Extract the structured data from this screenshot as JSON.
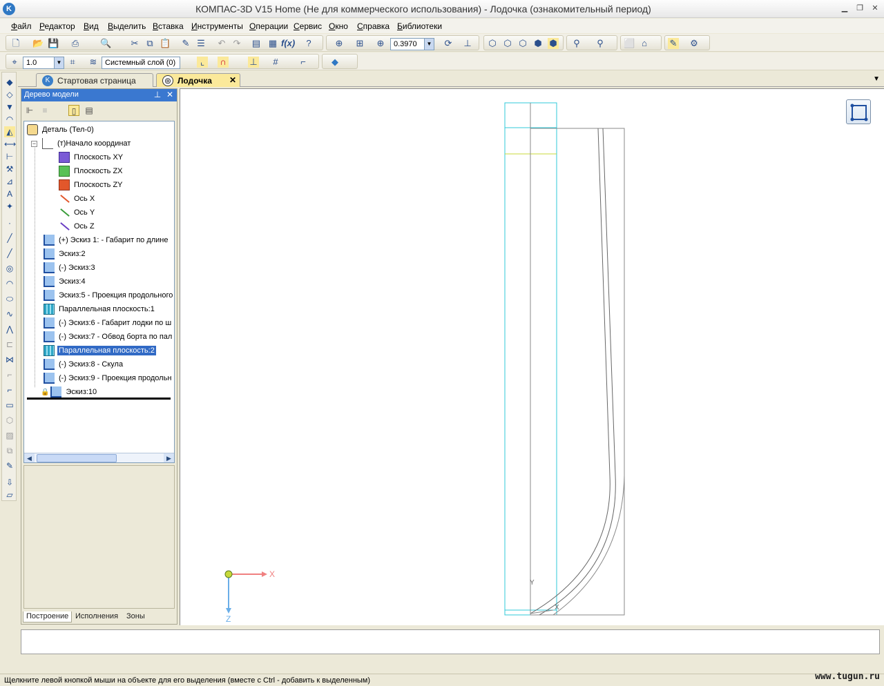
{
  "window": {
    "title": "КОМПАС-3D V15 Home (Не для коммерческого использования) - Лодочка (ознакомительный период)",
    "icon": "kompas-icon"
  },
  "menu": [
    "Файл",
    "Редактор",
    "Вид",
    "Выделить",
    "Вставка",
    "Инструменты",
    "Операции",
    "Сервис",
    "Окно",
    "Справка",
    "Библиотеки"
  ],
  "toolbar": {
    "zoom_value": "0.3970",
    "step_value": "1.0",
    "layer_value": "Системный слой (0)"
  },
  "tabs": [
    {
      "label": "Стартовая страница",
      "active": false
    },
    {
      "label": "Лодочка",
      "active": true
    }
  ],
  "tree_panel": {
    "title": "Дерево модели",
    "root": "Деталь (Тел-0)",
    "origin": "(т)Начало координат",
    "origin_children": [
      "Плоскость XY",
      "Плоскость ZX",
      "Плоскость ZY",
      "Ось X",
      "Ось Y",
      "Ось Z"
    ],
    "items": [
      "(+) Эскиз 1: - Габарит по длине",
      "Эскиз:2",
      "(-) Эскиз:3",
      "Эскиз:4",
      "Эскиз:5 - Проекция продольного",
      "Параллельная плоскость:1",
      "(-) Эскиз:6 - Габарит лодки по ш",
      "(-) Эскиз:7 - Обвод борта по пал",
      "Параллельная плоскость:2",
      "(-) Эскиз:8 - Скула",
      "(-) Эскиз:9 - Проекция продольн",
      "Эскиз:10"
    ],
    "selected_item": "Параллельная плоскость:2",
    "bottom_tabs": [
      "Построение",
      "Исполнения",
      "Зоны"
    ]
  },
  "canvas": {
    "axis_x_label": "X",
    "axis_z_label": "Z",
    "local_y_label": "Y",
    "local_x_label": "X"
  },
  "status_text": "Щелкните левой кнопкой мыши на объекте для его выделения (вместе с Ctrl - добавить к выделенным)",
  "watermark": "www.tugun.ru",
  "colors": {
    "selection": "#316ac5",
    "active_tab": "#fbe99a",
    "panel_header": "#3a78d0",
    "plane_outline": "#2fc8d8"
  }
}
